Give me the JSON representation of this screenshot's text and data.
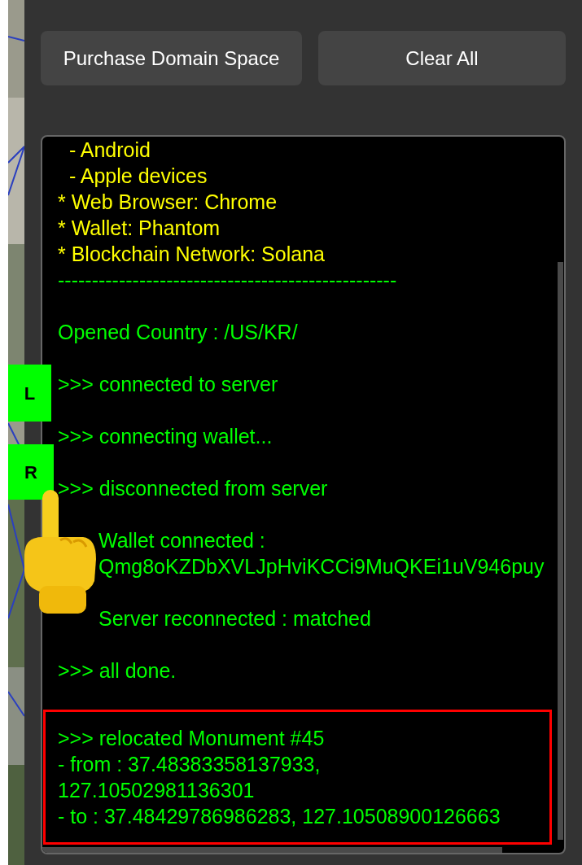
{
  "buttons": [
    {
      "label": "Purchase Domain Space"
    },
    {
      "label": "Clear All"
    }
  ],
  "log": [
    {
      "highlighted": false,
      "lines": [
        {
          "kind": "line",
          "text": "  - Android",
          "color": "#ffff00"
        },
        {
          "kind": "line",
          "text": "  - Apple devices",
          "color": "#ffff00"
        },
        {
          "kind": "line",
          "text": "* Web Browser: Chrome",
          "color": "#ffff00"
        },
        {
          "kind": "line",
          "text": "* Wallet: Phantom",
          "color": "#ffff00"
        },
        {
          "kind": "line",
          "text": "* Blockchain Network: Solana",
          "color": "#ffff00"
        },
        {
          "kind": "line",
          "text": "--------------------------------------------------",
          "color": "#00ff00"
        }
      ]
    },
    {
      "highlighted": false,
      "lines": [
        {
          "kind": "line",
          "text": "Opened Country : /US/KR/",
          "color": "#00ff00"
        }
      ]
    },
    {
      "highlighted": false,
      "lines": [
        {
          "kind": "line",
          "text": ">>> connected to server",
          "color": "#00ff00"
        }
      ]
    },
    {
      "highlighted": false,
      "lines": [
        {
          "kind": "line",
          "text": ">>> connecting wallet...",
          "color": "#00ff00"
        }
      ]
    },
    {
      "highlighted": false,
      "lines": [
        {
          "kind": "line",
          "text": ">>> disconnected from server",
          "color": "#00ff00"
        }
      ]
    },
    {
      "highlighted": false,
      "lines": [
        {
          "kind": "covered",
          "text": "Wallet connected :",
          "color": "#00ff00"
        },
        {
          "kind": "covered",
          "text": "Qmg8oKZDbXVLJpHviKCCi9MuQKEi1uV946puy",
          "color": "#00ff00"
        }
      ]
    },
    {
      "highlighted": false,
      "lines": [
        {
          "kind": "covered",
          "text": "Server reconnected : matched",
          "color": "#00ff00"
        }
      ]
    },
    {
      "highlighted": false,
      "lines": [
        {
          "kind": "line",
          "text": ">>> all done.",
          "color": "#00ff00"
        }
      ]
    },
    {
      "highlighted": true,
      "lines": [
        {
          "kind": "line",
          "text": ">>> relocated Monument #45",
          "color": "#00ff00"
        },
        {
          "kind": "line",
          "text": "- from : 37.48383358137933,",
          "color": "#00ff00"
        },
        {
          "kind": "line",
          "text": "127.10502981136301",
          "color": "#00ff00"
        },
        {
          "kind": "line",
          "text": "- to : 37.48429786986283, 127.10508900126663",
          "color": "#00ff00"
        }
      ]
    }
  ],
  "side_buttons": [
    {
      "label": "L"
    },
    {
      "label": "R"
    }
  ]
}
